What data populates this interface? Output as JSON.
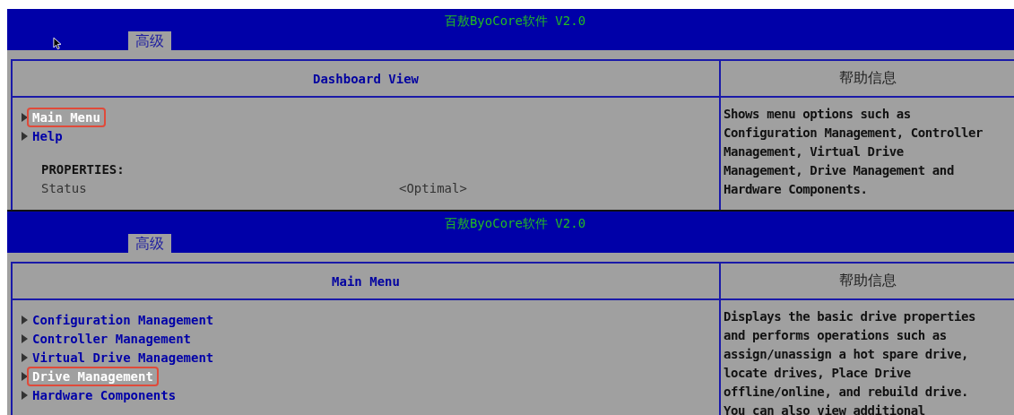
{
  "screens": [
    {
      "title": "百敖ByoCore软件 V2.0",
      "tab": {
        "label": "高级",
        "selected": true
      },
      "cursor": true,
      "panel_title": "Dashboard View",
      "help_title": "帮助信息",
      "items": [
        {
          "label": "Main Menu",
          "selected": true
        },
        {
          "label": "Help",
          "selected": false
        }
      ],
      "properties": {
        "heading": "PROPERTIES:",
        "rows": [
          {
            "name": "Status",
            "value": "<Optimal>"
          }
        ]
      },
      "help_lines": [
        "Shows menu options such as",
        "Configuration Management, Controller",
        "Management, Virtual Drive",
        "Management, Drive Management and",
        "Hardware Components."
      ]
    },
    {
      "title": "百敖ByoCore软件 V2.0",
      "tab": {
        "label": "高级",
        "selected": true
      },
      "cursor": false,
      "panel_title": "Main Menu",
      "help_title": "帮助信息",
      "items": [
        {
          "label": "Configuration Management",
          "selected": false
        },
        {
          "label": "Controller Management",
          "selected": false
        },
        {
          "label": "Virtual Drive Management",
          "selected": false
        },
        {
          "label": "Drive Management",
          "selected": true
        },
        {
          "label": "Hardware Components",
          "selected": false
        }
      ],
      "help_lines": [
        "Displays the basic drive properties",
        "and performs operations such as",
        "assign/unassign a hot spare drive,",
        "locate drives, Place Drive",
        "offline/online, and rebuild drive.",
        "You can also view additional"
      ]
    }
  ]
}
